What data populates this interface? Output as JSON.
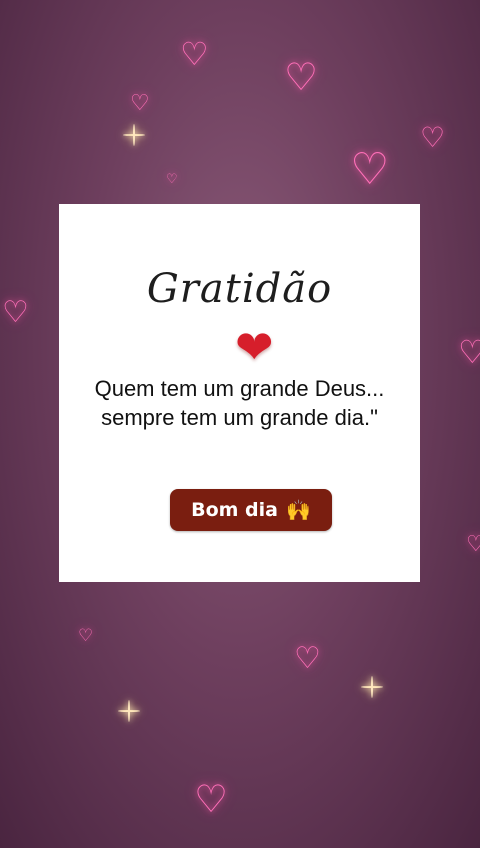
{
  "card": {
    "title": "Gratidão",
    "quote": "Quem tem um grande Deus... sempre tem um grande dia.\"",
    "badge_label": "Bom dia",
    "badge_icon": "🙌"
  },
  "colors": {
    "background": "#6e3f5e",
    "heart_glow": "#ff6fb8",
    "heart_red": "#d61e2b",
    "badge_bg": "#7a1e10"
  }
}
